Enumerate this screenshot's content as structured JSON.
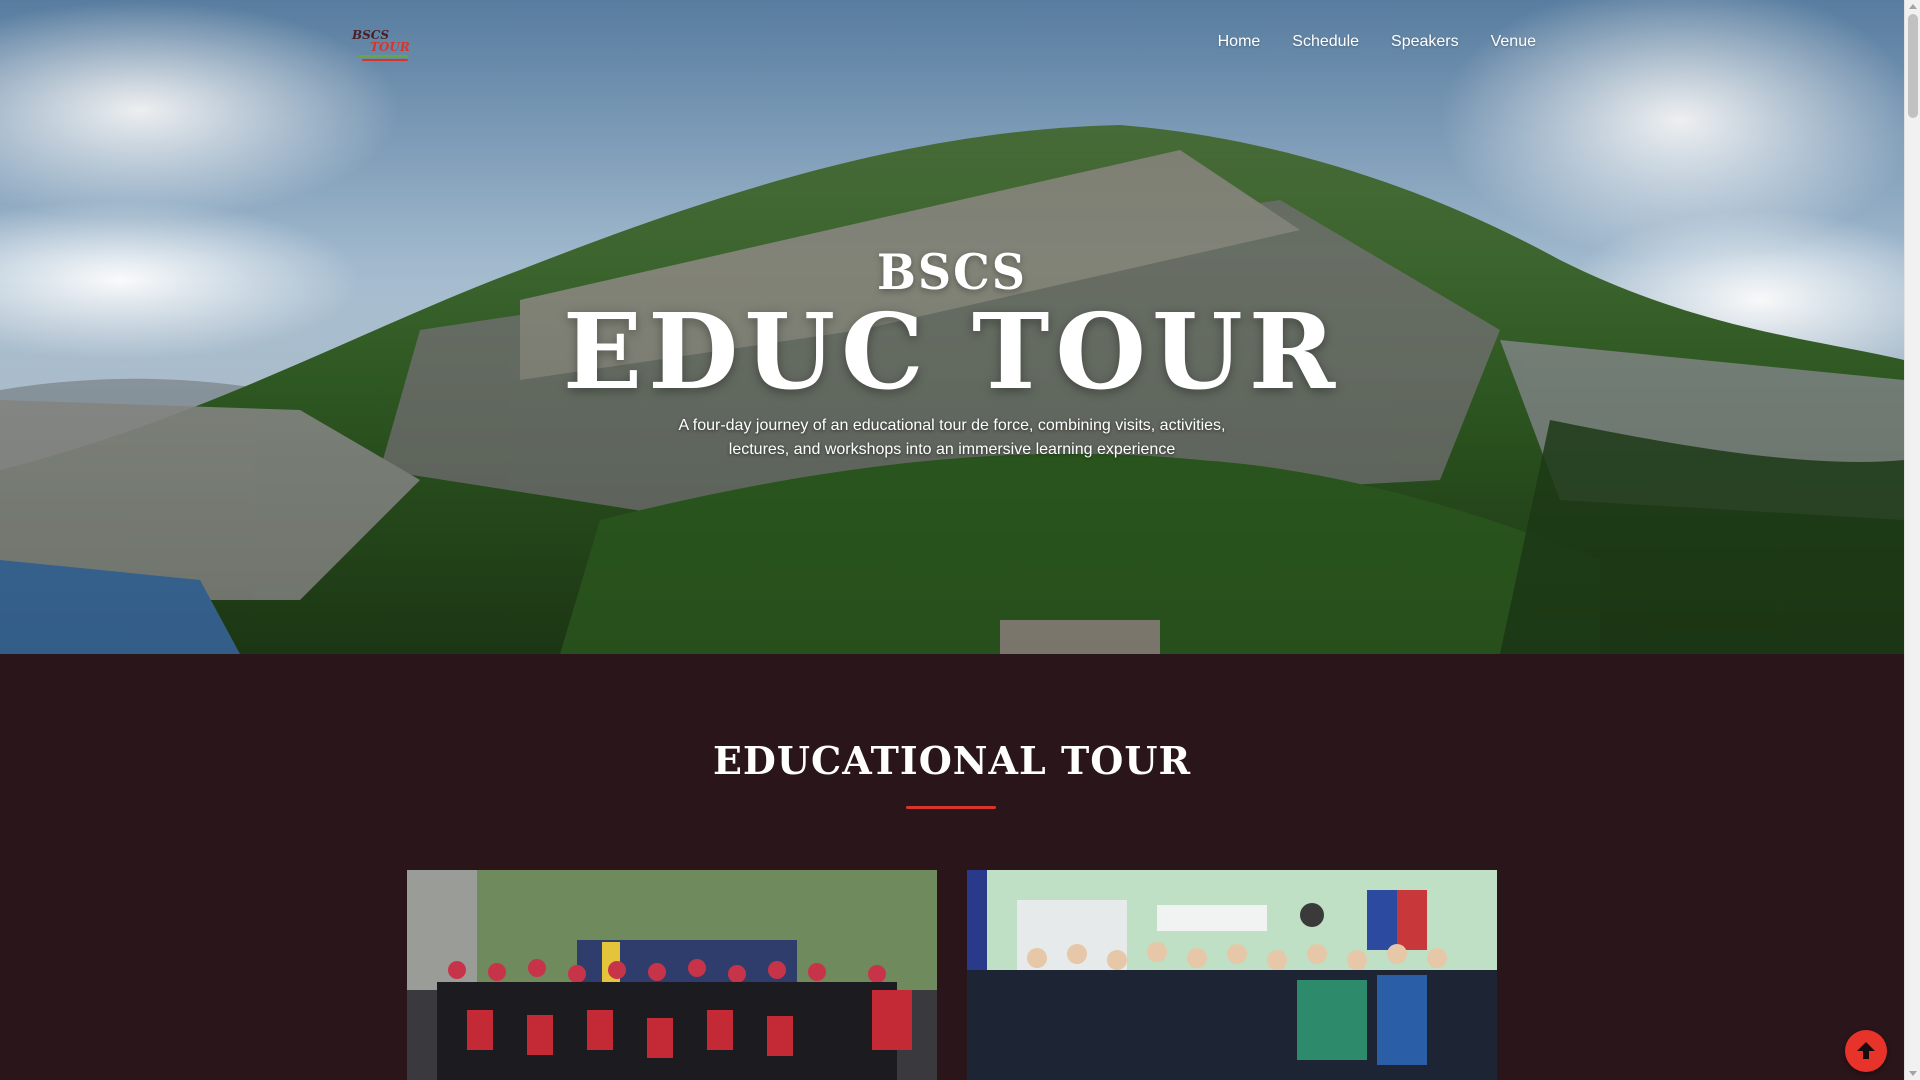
{
  "nav": {
    "logo": {
      "line1": "BSCS",
      "line2": "TOUR"
    },
    "links": [
      "Home",
      "Schedule",
      "Speakers",
      "Venue"
    ]
  },
  "hero": {
    "kicker": "BSCS",
    "title": "EDUC TOUR",
    "description_line1": "A four-day journey of an educational tour de force, combining visits, activities,",
    "description_line2": "lectures, and workshops into an immersive learning experience"
  },
  "section": {
    "title": "EDUCATIONAL TOUR",
    "accent_color": "#d8352a"
  },
  "icons": {
    "back_to_top": "arrow-up-icon"
  },
  "colors": {
    "section_bg": "#2a151a",
    "accent": "#e8332a"
  }
}
